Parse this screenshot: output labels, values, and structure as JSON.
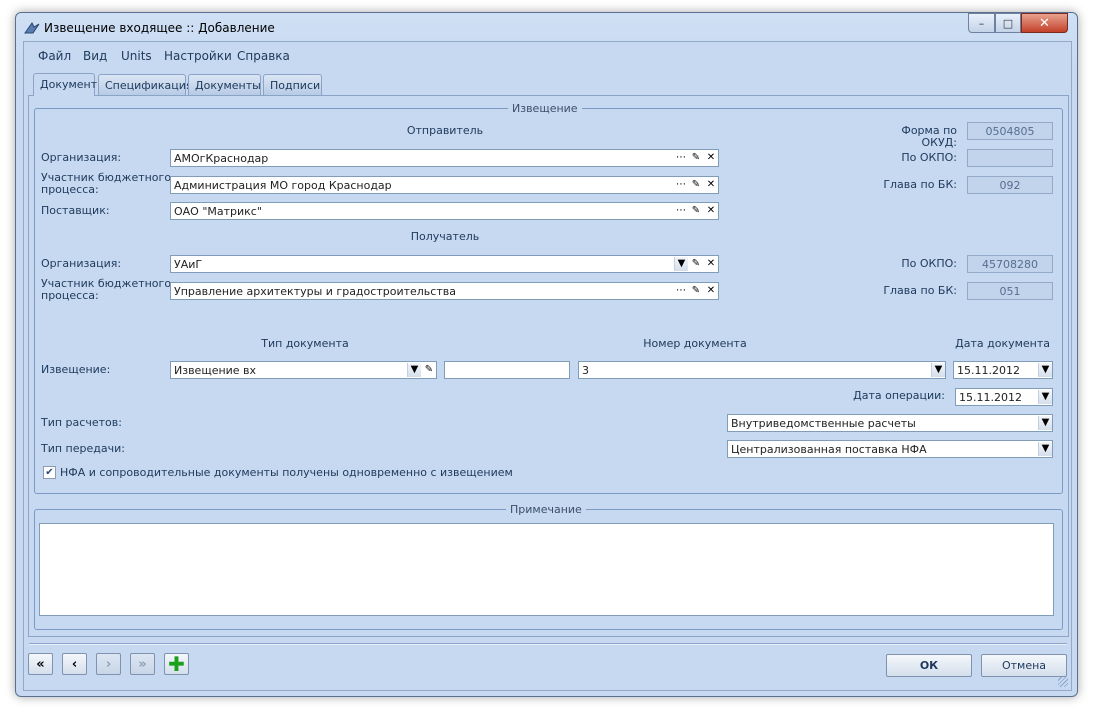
{
  "window": {
    "title": "Извещение входящее :: Добавление"
  },
  "menu": [
    "Файл",
    "Вид",
    "Units",
    "Настройки",
    "Справка"
  ],
  "tabs": [
    "Документ",
    "Спецификация",
    "Документы",
    "Подписи"
  ],
  "notice_group": {
    "legend": "Извещение",
    "sender_header": "Отправитель",
    "receiver_header": "Получатель",
    "sender": {
      "org_label": "Организация:",
      "org_value": "АМОгКраснодар",
      "budget_label_1": "Участник бюджетного",
      "budget_label_2": "процесса:",
      "budget_value": "Администрация МО город Краснодар",
      "supplier_label": "Поставщик:",
      "supplier_value": "ОАО \"Матрикс\""
    },
    "receiver": {
      "org_label": "Организация:",
      "org_value": "УАиГ",
      "budget_label_1": "Участник бюджетного",
      "budget_label_2": "процесса:",
      "budget_value": "Управление архитектуры и градостроительства"
    },
    "codes": {
      "okud_label": "Форма по ОКУД:",
      "okud_value": "0504805",
      "okpo_label": "По ОКПО:",
      "okpo_value": "",
      "bk_label": "Глава по БК:",
      "bk_value": "092",
      "okpo2_label": "По ОКПО:",
      "okpo2_value": "45708280",
      "bk2_label": "Глава по БК:",
      "bk2_value": "051"
    },
    "doc": {
      "type_header": "Тип документа",
      "number_header": "Номер документа",
      "date_header": "Дата документа",
      "notice_label": "Извещение:",
      "type_value": "Извещение вх",
      "extra_value": "",
      "number_value": "3",
      "date_value": "15.11.2012",
      "op_date_label": "Дата операции:",
      "op_date_value": "15.11.2012",
      "calc_label": "Тип расчетов:",
      "calc_value": "Внутриведомственные расчеты",
      "transfer_label": "Тип передачи:",
      "transfer_value": "Централизованная поставка НФА",
      "checkbox_label": "НФА и сопроводительные документы получены одновременно с извещением",
      "checkbox_checked": true
    }
  },
  "note_group": {
    "legend": "Примечание",
    "text": ""
  },
  "buttons": {
    "ok": "ОК",
    "cancel": "Отмена"
  }
}
